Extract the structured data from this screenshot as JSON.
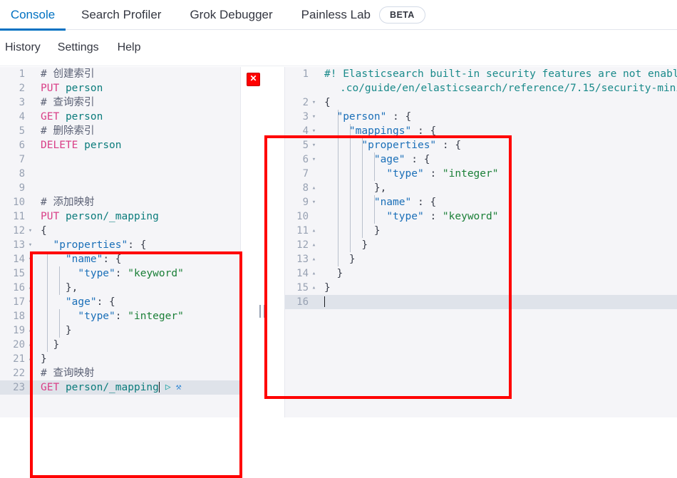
{
  "topnav": {
    "tabs": [
      {
        "label": "Console",
        "active": true
      },
      {
        "label": "Search Profiler",
        "active": false
      },
      {
        "label": "Grok Debugger",
        "active": false
      },
      {
        "label": "Painless Lab",
        "active": false
      }
    ],
    "badge": "BETA",
    "accent_color": "#0071c2"
  },
  "subnav": {
    "items": [
      {
        "label": "History"
      },
      {
        "label": "Settings"
      },
      {
        "label": "Help"
      }
    ]
  },
  "request_editor": {
    "close_button": "✕",
    "run_icon": "▷",
    "wrench_icon": "⚒",
    "lines": [
      {
        "n": "1",
        "fold": "",
        "text": "# 创建索引"
      },
      {
        "n": "2",
        "fold": "",
        "text": "PUT person"
      },
      {
        "n": "3",
        "fold": "",
        "text": "# 查询索引"
      },
      {
        "n": "4",
        "fold": "",
        "text": "GET person"
      },
      {
        "n": "5",
        "fold": "",
        "text": "# 删除索引"
      },
      {
        "n": "6",
        "fold": "",
        "text": "DELETE person"
      },
      {
        "n": "7",
        "fold": "",
        "text": ""
      },
      {
        "n": "8",
        "fold": "",
        "text": ""
      },
      {
        "n": "9",
        "fold": "",
        "text": ""
      },
      {
        "n": "10",
        "fold": "",
        "text": "# 添加映射"
      },
      {
        "n": "11",
        "fold": "",
        "text": "PUT person/_mapping"
      },
      {
        "n": "12",
        "fold": "▾",
        "text": "{"
      },
      {
        "n": "13",
        "fold": "▾",
        "text": "  \"properties\": {"
      },
      {
        "n": "14",
        "fold": "▾",
        "text": "    \"name\": {"
      },
      {
        "n": "15",
        "fold": "",
        "text": "      \"type\": \"keyword\""
      },
      {
        "n": "16",
        "fold": "▴",
        "text": "    },"
      },
      {
        "n": "17",
        "fold": "▾",
        "text": "    \"age\": {"
      },
      {
        "n": "18",
        "fold": "",
        "text": "      \"type\": \"integer\""
      },
      {
        "n": "19",
        "fold": "▴",
        "text": "    }"
      },
      {
        "n": "20",
        "fold": "▴",
        "text": "  }"
      },
      {
        "n": "21",
        "fold": "▴",
        "text": "}"
      },
      {
        "n": "22",
        "fold": "",
        "text": "# 查询映射"
      },
      {
        "n": "23",
        "fold": "",
        "text": "GET person/_mapping",
        "active": true
      }
    ]
  },
  "response_editor": {
    "warning_line_1": "#! Elasticsearch built-in security features are not enabl",
    "warning_line_2": ".co/guide/en/elasticsearch/reference/7.15/security-mini",
    "lines": [
      {
        "n": "2",
        "fold": "▾",
        "text": "{"
      },
      {
        "n": "3",
        "fold": "▾",
        "text": "  \"person\" : {"
      },
      {
        "n": "4",
        "fold": "▾",
        "text": "    \"mappings\" : {"
      },
      {
        "n": "5",
        "fold": "▾",
        "text": "      \"properties\" : {"
      },
      {
        "n": "6",
        "fold": "▾",
        "text": "        \"age\" : {"
      },
      {
        "n": "7",
        "fold": "",
        "text": "          \"type\" : \"integer\""
      },
      {
        "n": "8",
        "fold": "▴",
        "text": "        },"
      },
      {
        "n": "9",
        "fold": "▾",
        "text": "        \"name\" : {"
      },
      {
        "n": "10",
        "fold": "",
        "text": "          \"type\" : \"keyword\""
      },
      {
        "n": "11",
        "fold": "▴",
        "text": "        }"
      },
      {
        "n": "12",
        "fold": "▴",
        "text": "      }"
      },
      {
        "n": "13",
        "fold": "▴",
        "text": "    }"
      },
      {
        "n": "14",
        "fold": "▴",
        "text": "  }"
      },
      {
        "n": "15",
        "fold": "▴",
        "text": "}"
      },
      {
        "n": "16",
        "fold": "",
        "text": "",
        "active": true
      }
    ]
  },
  "annotations": {
    "accent_color": "#ff0000",
    "count": 2
  }
}
